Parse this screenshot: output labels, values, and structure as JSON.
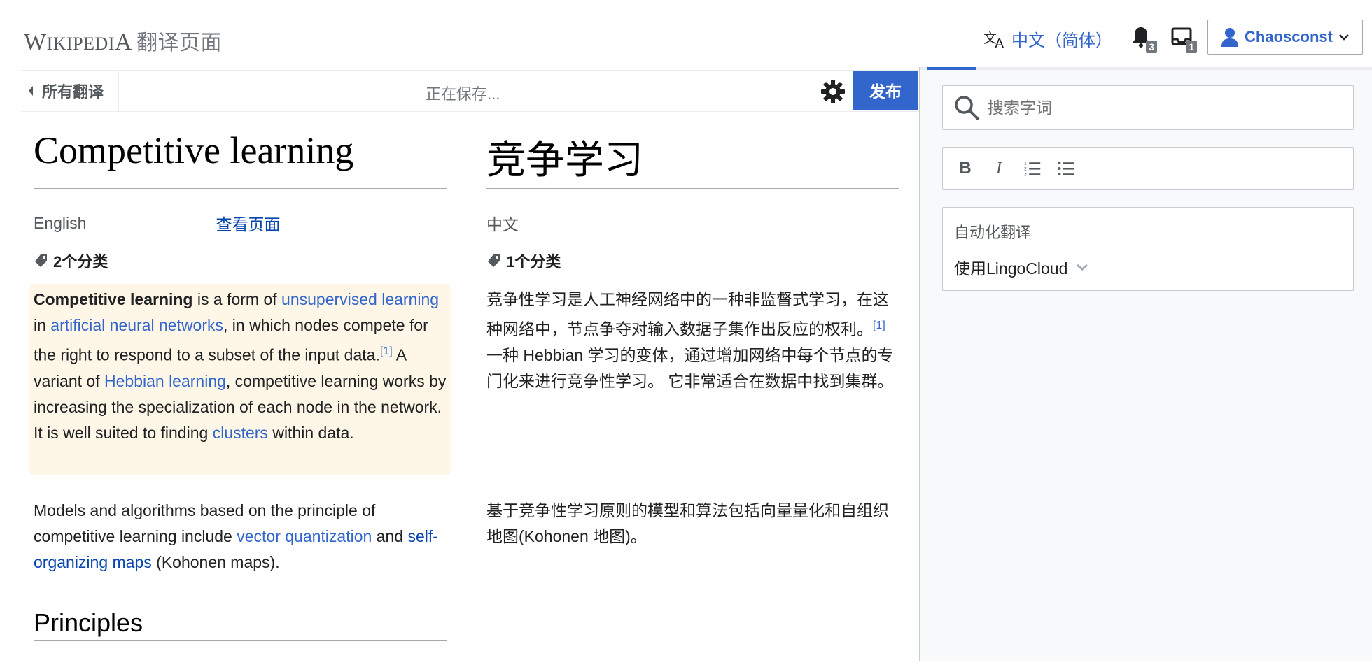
{
  "header": {
    "logo_w": "W",
    "logo_rest": "IKIPEDI",
    "logo_a": "A",
    "logo_sub": "翻译页面",
    "language": "中文（简体）",
    "notifications_alerts": "3",
    "notifications_notices": "1",
    "username": "Chaosconst"
  },
  "toolbar": {
    "back_label": "所有翻译",
    "status": "正在保存...",
    "publish_label": "发布"
  },
  "source": {
    "title": "Competitive learning",
    "language": "English",
    "view_page": "查看页面",
    "categories": "2个分类",
    "p1": {
      "bold": "Competitive learning",
      "t1": " is a form of ",
      "l1": "unsupervised learning",
      "t2": " in ",
      "l2": "artificial neural networks",
      "t3": ", in which nodes compete for the right to respond to a subset of the input data.",
      "ref": "[1]",
      "t4": " A variant of ",
      "l3": "Hebbian learning",
      "t5": ", competitive learning works by increasing the specialization of each node in the network. It is well suited to finding ",
      "l4": "clusters",
      "t6": " within data."
    },
    "p2": {
      "t1": "Models and algorithms based on the principle of competitive learning include ",
      "l1": "vector quantization",
      "t2": " and ",
      "l2": "self-organizing maps",
      "t3": " (Kohonen maps)."
    },
    "section_heading": "Principles"
  },
  "target": {
    "title": "竞争学习",
    "language": "中文",
    "categories": "1个分类",
    "p1": {
      "t1": "竞争性学习是人工神经网络中的一种非监督式学习，在这种网络中，节点争夺对输入数据子集作出反应的权利。",
      "ref": "[1]",
      "t2": " 一种 Hebbian 学习的变体，通过增加网络中每个节点的专门化来进行竞争性学习。 它非常适合在数据中找到集群。"
    },
    "p2": "基于竞争性学习原则的模型和算法包括向量量化和自组织地图(Kohonen 地图)。"
  },
  "sidebar": {
    "search_placeholder": "搜索字词",
    "format_bold": "B",
    "format_italic": "I",
    "mt_title": "自动化翻译",
    "mt_provider": "使用LingoCloud"
  },
  "colors": {
    "accent": "#3366cc",
    "highlight": "#fef6e7",
    "sidebar_bg": "#f8f9fa"
  }
}
